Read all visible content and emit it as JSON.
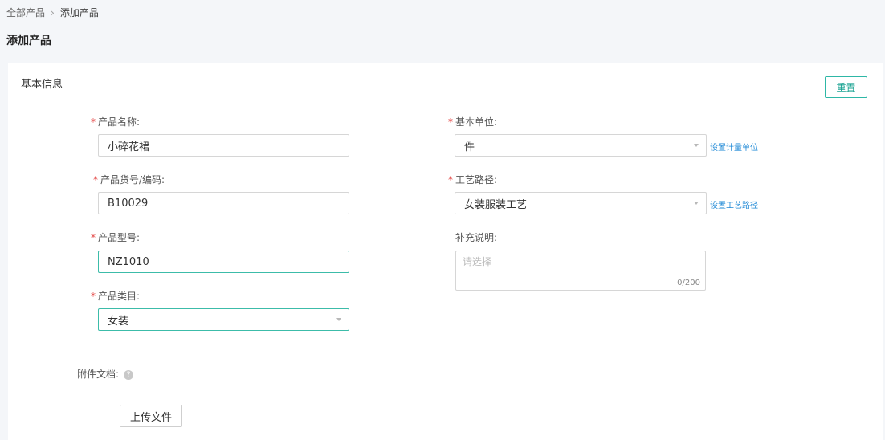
{
  "breadcrumb": {
    "root": "全部产品",
    "separator": "›",
    "current": "添加产品"
  },
  "page_title": "添加产品",
  "section": {
    "title": "基本信息",
    "reset_label": "重置"
  },
  "form": {
    "required_mark": "*",
    "product_name": {
      "label": "产品名称:",
      "value": "小碎花裙"
    },
    "product_code": {
      "label": "产品货号/编码:",
      "value": "B10029"
    },
    "product_model": {
      "label": "产品型号:",
      "value": "NZ1010"
    },
    "product_category": {
      "label": "产品类目:",
      "value": "女装"
    },
    "base_unit": {
      "label": "基本单位:",
      "value": "件",
      "link": "设置计量单位"
    },
    "process_route": {
      "label": "工艺路径:",
      "value": "女装服装工艺",
      "link": "设置工艺路径"
    },
    "notes": {
      "label": "补充说明:",
      "placeholder": "请选择",
      "counter": "0/200"
    },
    "attachments": {
      "label": "附件文档:",
      "help_glyph": "?",
      "upload_label": "上传文件"
    }
  },
  "colors": {
    "accent": "#2eb7a6",
    "required": "#e3413f",
    "link": "#1e88d6"
  }
}
